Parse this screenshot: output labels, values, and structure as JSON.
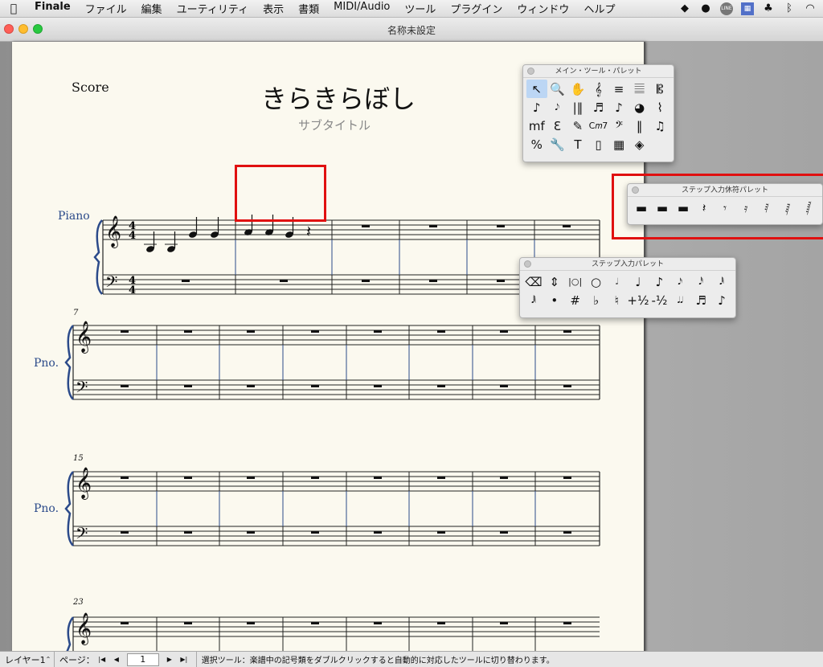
{
  "menubar": {
    "items": [
      "Finale",
      "ファイル",
      "編集",
      "ユーティリティ",
      "表示",
      "書類",
      "MIDI/Audio",
      "ツール",
      "プラグイン",
      "ウィンドウ",
      "ヘルプ"
    ],
    "right_icons": [
      "dropbox-icon",
      "creative-cloud-icon",
      "line-icon",
      "app-icon",
      "evernote-icon",
      "bluetooth-icon",
      "wifi-icon"
    ]
  },
  "window": {
    "title": "名称未設定"
  },
  "score": {
    "label": "Score",
    "title": "きらきらぼし",
    "subtitle": "サブタイトル",
    "system1": {
      "instrument": "Piano",
      "time_top": "4",
      "time_bottom": "4"
    },
    "system2": {
      "measure": "7",
      "instrument": "Pno."
    },
    "system3": {
      "measure": "15",
      "instrument": "Pno."
    },
    "system4": {
      "measure": "23",
      "instrument": "Pno."
    }
  },
  "main_palette": {
    "title": "メイン・ツール・パレット",
    "tools": [
      "↖",
      "🔍",
      "✋",
      "𝄞",
      "≡",
      "𝄚",
      "𝄡",
      "♪",
      "𝅘𝅥𝅮",
      "|‖",
      "♬",
      "♪",
      "◕",
      "⌇",
      "mf",
      "Ɛ",
      "✎",
      "C𝑚7",
      "𝄢",
      "‖",
      "♫",
      "%",
      "🔧",
      "T",
      "▯",
      "▦",
      "◈"
    ]
  },
  "rest_palette": {
    "title": "ステップ入力休符パレット",
    "tools": [
      "▬",
      "▬",
      "▬",
      "𝄽",
      "𝄾",
      "𝄿",
      "𝅀",
      "𝅁",
      "𝅂"
    ]
  },
  "step_palette": {
    "title": "ステップ入力パレット",
    "tools": [
      "⌫",
      "⇕",
      "|○|",
      "○",
      "𝅗𝅥",
      "♩",
      "♪",
      "𝅘𝅥𝅯",
      "𝅘𝅥𝅰",
      "𝅘𝅥𝅱",
      "𝅘𝅥𝅲",
      "•",
      "#",
      "♭",
      "♮",
      "+½",
      "-½",
      "𝅘𝅥𝅘𝅥",
      "♬",
      "♪"
    ]
  },
  "statusbar": {
    "layer": "レイヤー1",
    "page_label": "ページ：",
    "page_value": "1",
    "message": "選択ツール：楽譜中の記号類をダブルクリックすると自動的に対応したツールに切り替わります。"
  },
  "colors": {
    "highlight": "#e01010",
    "instrument_blue": "#2b4a8a",
    "barline_blue": "#2b4a8a"
  }
}
